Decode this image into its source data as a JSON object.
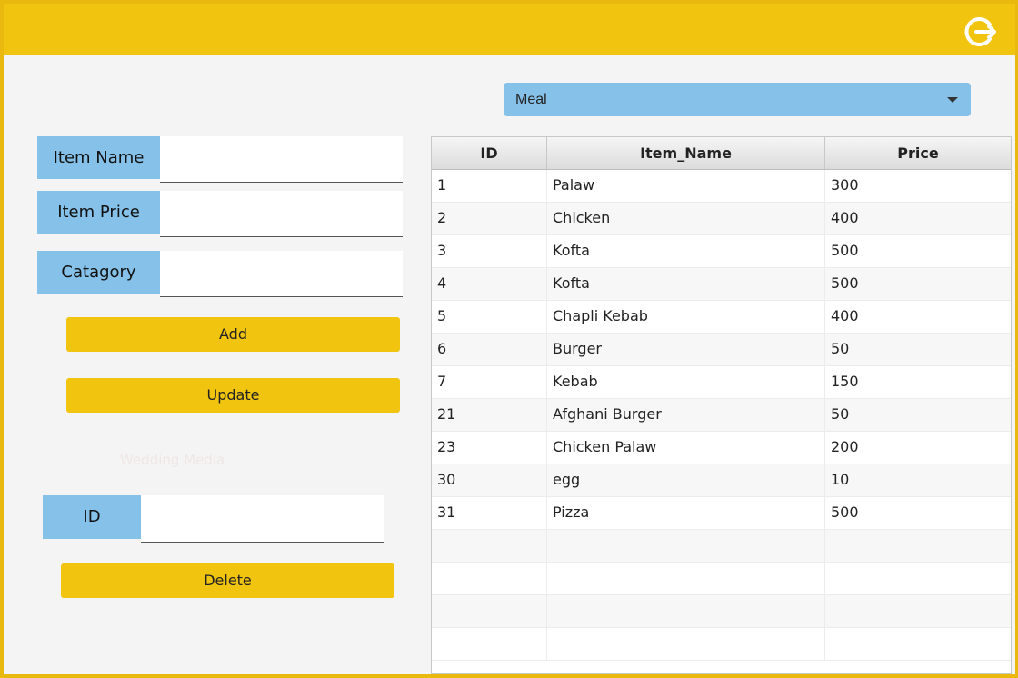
{
  "header": {
    "logout_icon": "logout-icon"
  },
  "filter": {
    "selected": "Meal"
  },
  "form": {
    "item_name_label": "Item Name",
    "item_price_label": "Item Price",
    "category_label": "Catagory",
    "item_name_value": "",
    "item_price_value": "",
    "category_value": "",
    "add_label": "Add",
    "update_label": "Update",
    "faint_text": "Wedding Media",
    "id_label": "ID",
    "id_value": "",
    "delete_label": "Delete"
  },
  "table": {
    "columns": [
      "ID",
      "Item_Name",
      "Price"
    ],
    "rows": [
      [
        "1",
        "Palaw",
        "300"
      ],
      [
        "2",
        "Chicken",
        "400"
      ],
      [
        "3",
        "Kofta",
        "500"
      ],
      [
        "4",
        "Kofta",
        "500"
      ],
      [
        "5",
        "Chapli Kebab",
        "400"
      ],
      [
        "6",
        "Burger",
        "50"
      ],
      [
        "7",
        "Kebab",
        "150"
      ],
      [
        "21",
        "Afghani Burger",
        "50"
      ],
      [
        "23",
        "Chicken Palaw",
        "200"
      ],
      [
        "30",
        "egg",
        "10"
      ],
      [
        "31",
        "Pizza",
        "500"
      ]
    ]
  },
  "colors": {
    "accent": "#f1c40f",
    "label_bg": "#85c1e9"
  }
}
